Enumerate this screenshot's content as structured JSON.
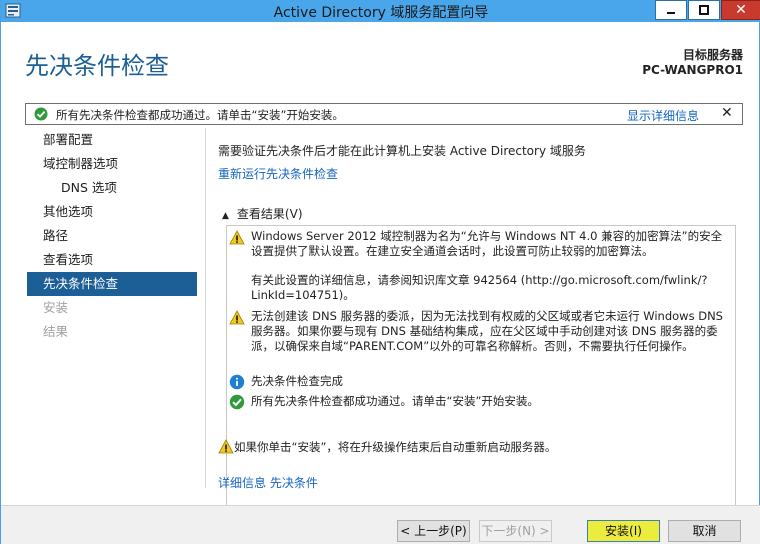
{
  "window": {
    "title": "Active Directory 域服务配置向导",
    "close_glyph": "✕"
  },
  "header": {
    "title": "先决条件检查",
    "target_label": "目标服务器",
    "target_server": "PC-WANGPRO1"
  },
  "notification": {
    "message": "所有先决条件检查都成功通过。请单击“安装”开始安装。",
    "details_link": "显示详细信息",
    "close": "✕"
  },
  "nav": {
    "items": [
      {
        "label": "部署配置",
        "state": "normal"
      },
      {
        "label": "域控制器选项",
        "state": "normal"
      },
      {
        "label": "DNS 选项",
        "state": "normal",
        "sub": true
      },
      {
        "label": "其他选项",
        "state": "normal"
      },
      {
        "label": "路径",
        "state": "normal"
      },
      {
        "label": "查看选项",
        "state": "normal"
      },
      {
        "label": "先决条件检查",
        "state": "active"
      },
      {
        "label": "安装",
        "state": "disabled"
      },
      {
        "label": "结果",
        "state": "disabled"
      }
    ]
  },
  "main": {
    "intro": "需要验证先决条件后才能在此计算机上安装 Active Directory 域服务",
    "rerun_link": "重新运行先决条件检查",
    "results_header": "查看结果(V)",
    "results_chevron": "▲",
    "results": [
      {
        "icon": "warning-icon",
        "text": "Windows Server 2012 域控制器为名为“允许与 Windows NT 4.0 兼容的加密算法”的安全设置提供了默认设置。在建立安全通道会话时，此设置可防止较弱的加密算法。"
      },
      {
        "icon": "none",
        "text": "有关此设置的详细信息，请参阅知识库文章 942564 (http://go.microsoft.com/fwlink/?LinkId=104751)。"
      },
      {
        "icon": "warning-icon",
        "text": "无法创建该 DNS 服务器的委派，因为无法找到有权威的父区域或者它未运行 Windows DNS 服务器。如果你要与现有 DNS 基础结构集成，应在父区域中手动创建对该 DNS 服务器的委派，以确保来自域“PARENT.COM”以外的可靠名称解析。否则，不需要执行任何操作。"
      },
      {
        "icon": "info-icon",
        "text": "先决条件检查完成"
      },
      {
        "icon": "check-icon",
        "text": "所有先决条件检查都成功通过。请单击“安装”开始安装。"
      }
    ],
    "restart_warning": "如果你单击“安装”，将在升级操作结束后自动重新启动服务器。",
    "more_info_link": "详细信息 先决条件"
  },
  "footer": {
    "prev": "< 上一步(P)",
    "next": "下一步(N) >",
    "install": "安装(I)",
    "cancel": "取消"
  },
  "colors": {
    "title_bar": "#4aa6eb",
    "accent": "#1c5f96",
    "link": "#1565c0",
    "install_highlight": "#ecec3c"
  }
}
